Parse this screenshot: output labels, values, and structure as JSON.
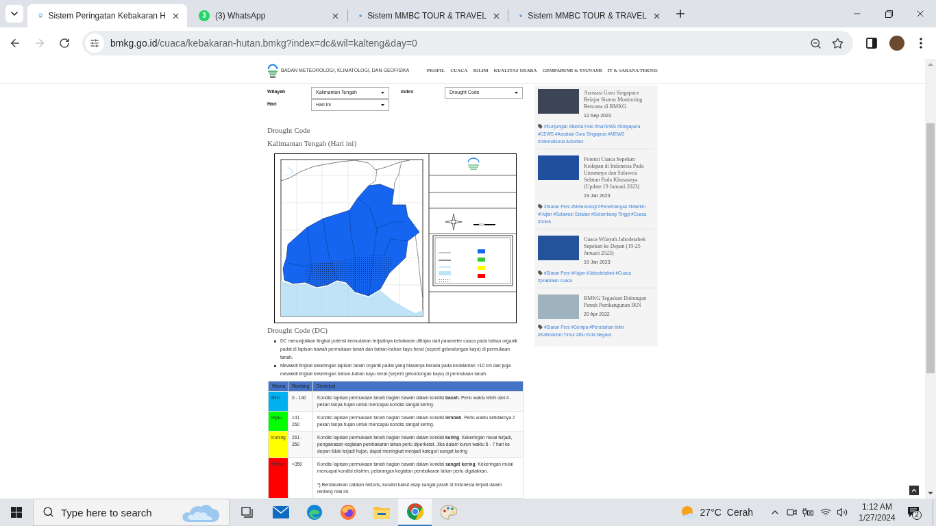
{
  "browser": {
    "tabs": [
      {
        "kind": "bmkg",
        "title": "Sistem Peringatan Kebakaran H",
        "selected": true
      },
      {
        "kind": "whatsapp",
        "title": "(3) WhatsApp",
        "badge": "3",
        "selected": false
      },
      {
        "kind": "mmbc",
        "title": "Sistem MMBC TOUR & TRAVEL",
        "selected": false
      },
      {
        "kind": "mmbc",
        "title": "Sistem MMBC TOUR & TRAVEL",
        "selected": false
      }
    ],
    "nav_buttons": [
      {
        "kind": "back",
        "disabled": false
      },
      {
        "kind": "forward",
        "disabled": true
      },
      {
        "kind": "reload",
        "disabled": false
      }
    ],
    "address": {
      "domain": "bmkg.go.id",
      "path": "/cuaca/kebakaran-hutan.bmkg?index=dc&wil=kalteng&day=0"
    }
  },
  "site_header": {
    "org_name": "BADAN METEOROLOGI, KLIMATOLOGI, DAN GEOFISIKA",
    "nav": [
      "PROFIL",
      "CUACA",
      "IKLIM",
      "KUALITAS UDARA",
      "GEMPABUMI & TSUNAMI",
      "IT & SARANA TEKNIS"
    ]
  },
  "filters": [
    {
      "label": "Wilayah",
      "value": "Kalimantan Tengah"
    },
    {
      "label": "Index",
      "value": "Drought Code"
    },
    {
      "label": "Hari",
      "value": "Hari ini"
    }
  ],
  "content": {
    "title": "Drought Code",
    "subtitle": "Kalimantan Tengah (Hari ini)",
    "section_title": "Drought Code (DC)",
    "bullets": [
      "DC menunjukkan tingkat potensi kemudahan terjadinya kebakaran ditinjau dari parameter cuaca pada bahan organik padat di lapisan bawah permukaan tanah dan bahan-bahan kayu berat (seperti gelondongan kayu) di permukaan tanah.",
      "Mewakili tingkat kekeringan lapisan tanah organik padat yang biasanya berada pada kedalaman >10 cm dan juga mewakili tingkat kekeringan bahan-bahan kayu berat (seperti gelondongan kayu) di permukaan tanah."
    ],
    "table": {
      "columns": [
        "Warna",
        "Rentang",
        "Deskripsi"
      ],
      "rows": [
        {
          "warna": "Biru",
          "color": "#00b0f0",
          "rentang": "0 - 140",
          "deskripsi": "Kondisi lapisan permukaan tanah bagian bawah dalam kondisi **basah**. Perlu waktu lebih dari 4 pekan tanpa hujan untuk mencapai kondisi sangat kering."
        },
        {
          "warna": "Hijau",
          "color": "#00ff00",
          "rentang": "141 - 260",
          "deskripsi": "Kondisi lapisan permukaan tanah bagian bawah dalam kondisi **lembab**. Perlu waktu setidaknya 2 pekan tanpa hujan untuk mencapai kondisi sangat kering."
        },
        {
          "warna": "Kuning",
          "color": "#ffff00",
          "rentang": "261 - 350",
          "deskripsi": "Kondisi lapisan permukaan tanah bagian bawah dalam kondisi **kering**. Kekeringan mulai terjadi, pengawasan kegiatan pembakaran lahan perlu diperketat. Jika dalam kurun waktu 5 - 7 hari ke depan tidak terjadi hujan, dapat meningkat menjadi kategori sangat kering"
        },
        {
          "warna": "Merah",
          "color": "#ff0000",
          "rentang": ">350",
          "deskripsi": "Kondisi lapisan permukaan tanah bagian bawah dalam kondisi **sangat kering**. Kekeringan mulai mencapai kondisi ekstrim, pelarangan kegiatan pembakaran lahan perlu digalakkan.",
          "note": "*) Berdasarkan catatan historis, kondisi kabut asap sangat parah di Indonesia terjadi dalam rentang nilai ini."
        }
      ]
    }
  },
  "sidebar": {
    "news": [
      {
        "title": "Asosiasi Guru Singapura Belajar Sistem Monitoring Bencana di BMKG",
        "date": "12 Sep 2023",
        "tags": [
          "#Kunjungan",
          "#Berita Foto",
          "#InaTEWS",
          "#Singapura",
          "#CEWS",
          "#Asosiasi Guru Singapura",
          "#MEWS",
          "#International Activities"
        ]
      },
      {
        "title": "Potensi Cuaca Sepekan Kedepan di Indonesia Pada Umumnya dan Sulawesi Selatan Pada Khususnya (Update 19 Januari 2023)",
        "date": "19 Jan 2023",
        "tags": [
          "#Siaran Pers",
          "#Meteorologi",
          "#Penerbangan",
          "#Maritim",
          "#Hujan",
          "#Sulawesi Selatan",
          "#Gelombang Tinggi",
          "#Cuaca",
          "#Imlek"
        ]
      },
      {
        "title": "Cuaca Wilayah Jabodetabek Sepekan ke Depan (19-25 Januari 2023)",
        "date": "19 Jan 2023",
        "tags": [
          "#Siaran Pers",
          "#Hujan",
          "#Jabodetabek",
          "#Cuaca",
          "#prakiraan cuaca"
        ]
      },
      {
        "title": "BMKG Tegaskan Dukungan Penuh Pembangunan IKN",
        "date": "20 Apr 2022",
        "tags": [
          "#Siaran Pers",
          "#Gempa",
          "#Perubahan Iklim",
          "#Kalimantan Timur",
          "#Ibu Kota Negara"
        ]
      }
    ]
  },
  "taskbar": {
    "search": {
      "placeholder": "Type here to search"
    },
    "apps": [
      {
        "kind": "task_view",
        "selected": false
      },
      {
        "kind": "mail",
        "selected": false
      },
      {
        "kind": "edge",
        "selected": false
      },
      {
        "kind": "firefox",
        "selected": false
      },
      {
        "kind": "explorer",
        "selected": false
      },
      {
        "kind": "chrome",
        "selected": true
      },
      {
        "kind": "paint",
        "selected": false
      }
    ],
    "weather": {
      "temperature": "27°C",
      "condition": "Cerah"
    },
    "time": "1:12 AM",
    "date": "1/27/2024",
    "notifications": "2"
  }
}
